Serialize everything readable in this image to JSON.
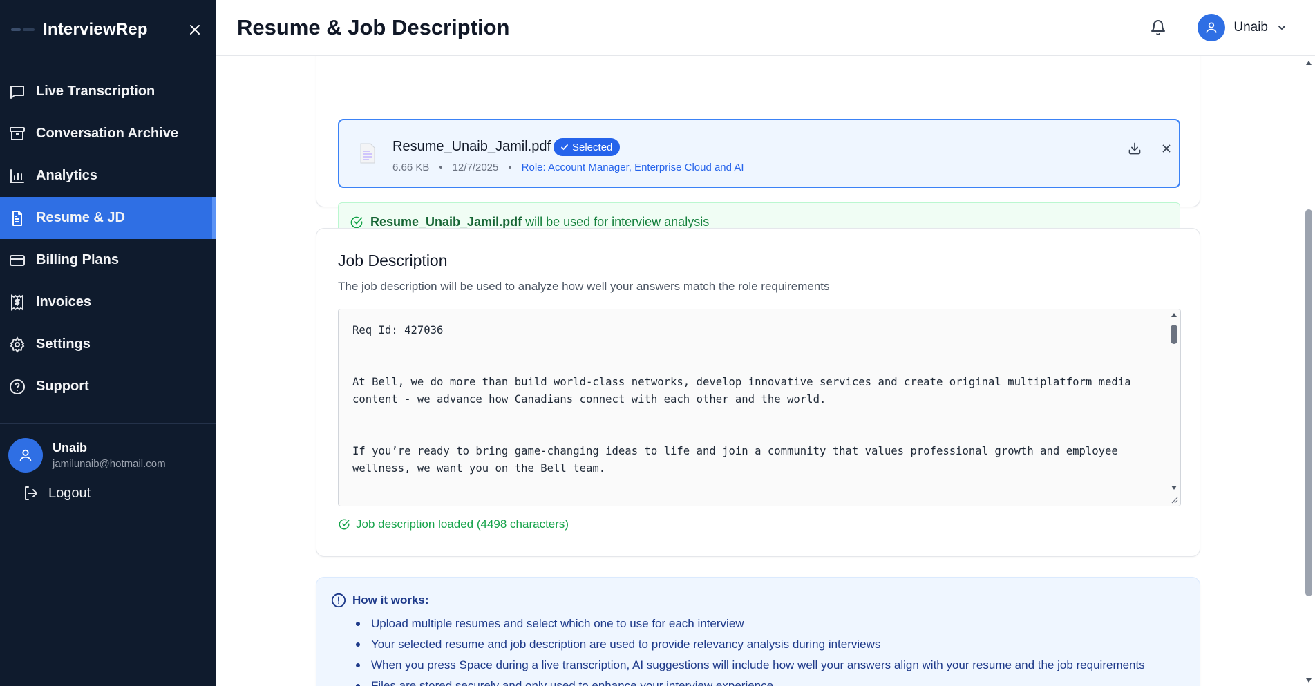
{
  "sidebar": {
    "brand": "InterviewRep",
    "items": [
      {
        "label": "Live Transcription",
        "icon": "chat-icon"
      },
      {
        "label": "Conversation Archive",
        "icon": "archive-icon"
      },
      {
        "label": "Analytics",
        "icon": "bar-chart-icon"
      },
      {
        "label": "Resume & JD",
        "icon": "document-icon",
        "active": true
      },
      {
        "label": "Billing Plans",
        "icon": "credit-card-icon"
      },
      {
        "label": "Invoices",
        "icon": "receipt-dollar-icon"
      },
      {
        "label": "Settings",
        "icon": "gear-icon"
      },
      {
        "label": "Support",
        "icon": "help-circle-icon"
      }
    ],
    "user": {
      "name": "Unaib",
      "email": "jamilunaib@hotmail.com"
    },
    "logout_label": "Logout"
  },
  "header": {
    "title": "Resume & Job Description",
    "user_name": "Unaib"
  },
  "resume": {
    "file_name": "Resume_Unaib_Jamil.pdf",
    "badge": "Selected",
    "size": "6.66 KB",
    "date": "12/7/2025",
    "role": "Role: Account Manager, Enterprise Cloud and AI",
    "separator": "•",
    "success_file": "Resume_Unaib_Jamil.pdf",
    "success_text": "will be used for interview analysis"
  },
  "job_description": {
    "title": "Job Description",
    "description": "The job description will be used to analyze how well your answers match the role requirements",
    "text": "Req Id: 427036\n\n\nAt Bell, we do more than build world-class networks, develop innovative services and create original multiplatform media content - we advance how Canadians connect with each other and the world.\n\n\nIf you’re ready to bring game-changing ideas to life and join a community that values professional growth and employee wellness, we want you on the Bell team.",
    "status": "Job description loaded (4498 characters)"
  },
  "how_it_works": {
    "title": "How it works:",
    "items": [
      "Upload multiple resumes and select which one to use for each interview",
      "Your selected resume and job description are used to provide relevancy analysis during interviews",
      "When you press Space during a live transcription, AI suggestions will include how well your answers align with your resume and the job requirements",
      "Files are stored securely and only used to enhance your interview experience"
    ]
  },
  "colors": {
    "sidebar_bg": "#0f1b2d",
    "accent": "#2f6fe4",
    "success": "#16a34a",
    "info_bg": "#eff6ff"
  }
}
